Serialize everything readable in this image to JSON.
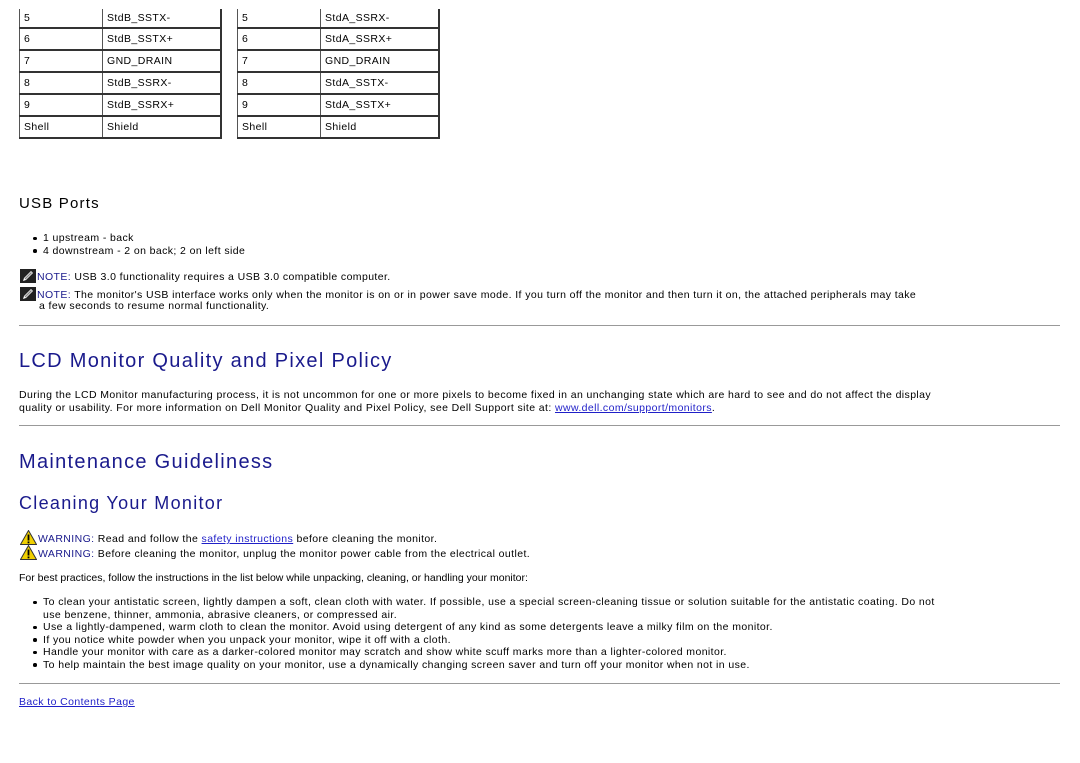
{
  "pin_tables": {
    "left": [
      [
        "5",
        "StdB_SSTX-"
      ],
      [
        "6",
        "StdB_SSTX+"
      ],
      [
        "7",
        "GND_DRAIN"
      ],
      [
        "8",
        "StdB_SSRX-"
      ],
      [
        "9",
        "StdB_SSRX+"
      ],
      [
        "Shell",
        "Shield"
      ]
    ],
    "right": [
      [
        "5",
        "StdA_SSRX-"
      ],
      [
        "6",
        "StdA_SSRX+"
      ],
      [
        "7",
        "GND_DRAIN"
      ],
      [
        "8",
        "StdA_SSTX-"
      ],
      [
        "9",
        "StdA_SSTX+"
      ],
      [
        "Shell",
        "Shield"
      ]
    ]
  },
  "usb_ports": {
    "heading": "USB Ports",
    "items": [
      "1 upstream - back",
      "4 downstream - 2 on back; 2 on left side"
    ],
    "notes": [
      {
        "label": "NOTE:",
        "text": " USB 3.0 functionality requires a USB 3.0 compatible computer.",
        "icon": "note-pencil-icon"
      },
      {
        "label": "NOTE:",
        "text": " The monitor's USB interface works only when the monitor is on or in power save mode. If you turn off the monitor and then turn it on, the attached peripherals may take",
        "continuation": "a few seconds to resume normal functionality.",
        "icon": "note-pencil-icon"
      }
    ]
  },
  "lcd_policy": {
    "heading": "LCD Monitor Quality and Pixel Policy",
    "text_line1": "During the LCD Monitor manufacturing process, it is not uncommon for one or more pixels to become fixed in an unchanging state which are hard to see and do not affect the display",
    "text_line2": "quality or usability. For more information on Dell Monitor Quality and Pixel Policy, see Dell Support site at: ",
    "link": "www.dell.com/support/monitors",
    "text_end": "."
  },
  "maintenance": {
    "heading": "Maintenance Guideliness",
    "subheading": "Cleaning Your Monitor",
    "warnings": [
      {
        "label": "WARNING:",
        "before": " Read and follow the ",
        "link": "safety instructions",
        "after": " before cleaning the monitor.",
        "icon": "warning-triangle-icon"
      },
      {
        "label": "WARNING:",
        "before": " Before cleaning the monitor, unplug the monitor power cable from the electrical outlet.",
        "icon": "warning-triangle-icon"
      }
    ],
    "intro": "For best practices, follow the instructions in the list below while unpacking, cleaning, or handling your monitor:",
    "items": [
      "To clean your antistatic screen, lightly dampen a soft, clean cloth with water. If possible, use a special screen-cleaning tissue or solution suitable for the antistatic coating. Do not",
      "use benzene, thinner, ammonia, abrasive cleaners, or compressed air.",
      "Use a lightly-dampened, warm cloth to clean the monitor. Avoid using detergent of any kind as some detergents leave a milky film on the monitor.",
      "If you notice white powder when you unpack your monitor, wipe it off with a cloth.",
      "Handle your monitor with care as a darker-colored monitor may scratch and show white scuff marks more than a lighter-colored monitor.",
      "To help maintain the best image quality on your monitor, use a dynamically changing screen saver and turn off your monitor when not in use."
    ]
  },
  "footer": {
    "back_link": "Back to Contents Page"
  }
}
